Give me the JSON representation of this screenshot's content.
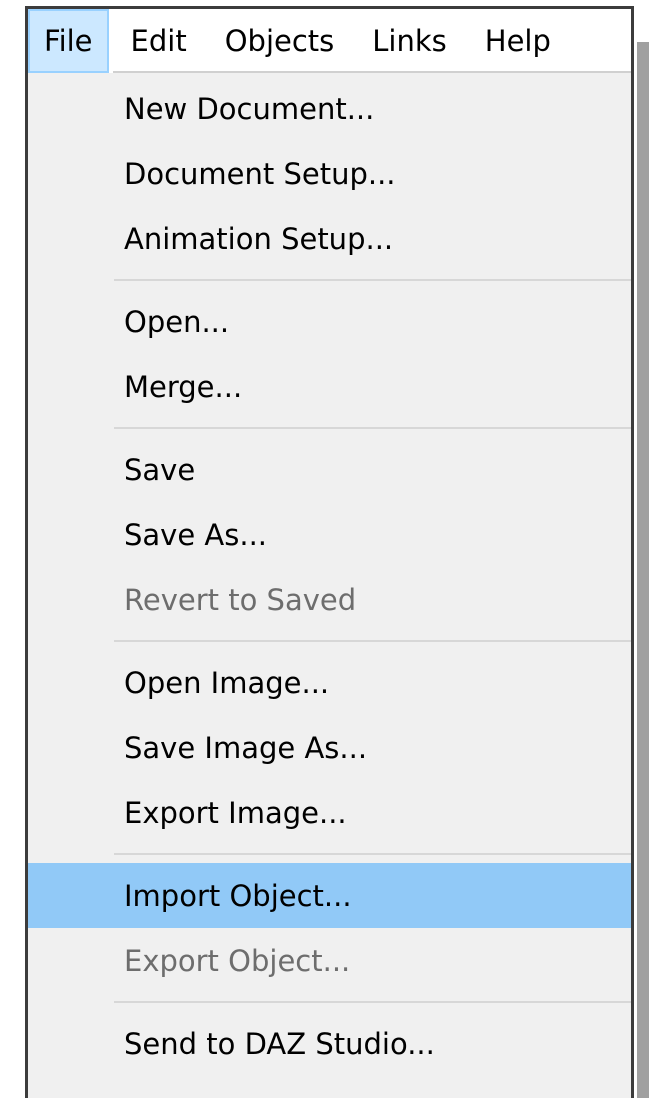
{
  "menubar": {
    "items": [
      {
        "label": "File",
        "active": true
      },
      {
        "label": "Edit",
        "active": false
      },
      {
        "label": "Objects",
        "active": false
      },
      {
        "label": "Links",
        "active": false
      },
      {
        "label": "Help",
        "active": false
      }
    ]
  },
  "file_menu": {
    "groups": [
      [
        "New Document...",
        "Document Setup...",
        "Animation Setup..."
      ],
      [
        "Open...",
        "Merge..."
      ],
      [
        "Save",
        "Save As...",
        "Revert to Saved"
      ],
      [
        "Open Image...",
        "Save Image As...",
        "Export Image..."
      ],
      [
        "Import Object...",
        "Export Object..."
      ],
      [
        "Send to DAZ Studio..."
      ]
    ],
    "items": {
      "new_document": "New Document...",
      "document_setup": "Document Setup...",
      "animation_setup": "Animation Setup...",
      "open": "Open...",
      "merge": "Merge...",
      "save": "Save",
      "save_as": "Save As...",
      "revert_to_saved": "Revert to Saved",
      "open_image": "Open Image...",
      "save_image_as": "Save Image As...",
      "export_image": "Export Image...",
      "import_object": "Import Object...",
      "export_object": "Export Object...",
      "send_to_daz_studio": "Send to DAZ Studio..."
    },
    "disabled": [
      "Revert to Saved",
      "Export Object..."
    ],
    "highlighted": "Import Object..."
  },
  "colors": {
    "highlight": "#91c9f7",
    "active_menubar": "#cce8ff",
    "disabled_text": "#6d6d6d",
    "menu_background": "#f0f0f0"
  }
}
